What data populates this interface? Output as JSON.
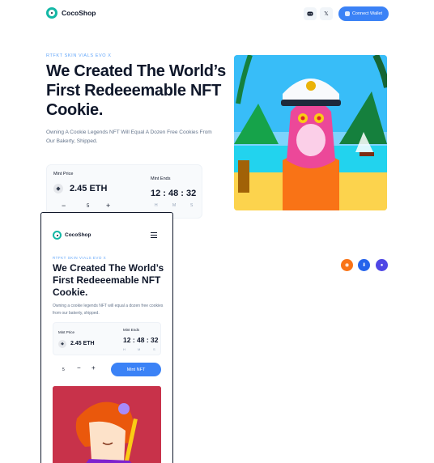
{
  "header": {
    "logo_text": "CocoShop",
    "discord_icon": "discord-icon",
    "x_icon": "𝕏",
    "connect_label": "Connect Wallet",
    "accent": "#3b82f6"
  },
  "hero": {
    "kicker": "RTFKT SKIN VIALS EVO X",
    "title": "We Created The World’s First Redeeemable NFT Cookie.",
    "subtitle": "Owning A Cookie Legends NFT Will Equal A Dozen Free Cookies From Our Bakerty, Shipped.",
    "mint": {
      "price_label": "Mint Price",
      "price": "2.45 ETH",
      "ends_label": "Mint Ends",
      "timer": "12 : 48 : 32",
      "hours_label": "H",
      "minutes_label": "M",
      "seconds_label": "S",
      "minus": "−",
      "quantity": "5",
      "plus": "+"
    }
  },
  "socials": [
    {
      "name": "rss-icon",
      "color": "#f97316"
    },
    {
      "name": "download-icon",
      "color": "#2563eb"
    },
    {
      "name": "badge-icon",
      "color": "#4f46e5"
    }
  ],
  "mobile": {
    "logo_text": "CocoShop",
    "kicker": "RTFKT SKIN VIALS EVO X",
    "title": "We Created The World’s First Redeeemable NFT Cookie.",
    "subtitle": "Owning a cookie legends NFT will equal a dozen free cookies from our bakerty, shipped.",
    "price_label": "Mint Price",
    "price": "2.45 ETH",
    "ends_label": "Mint Ends",
    "timer": "12 : 48 : 32",
    "hours_label": "H",
    "minutes_label": "M",
    "seconds_label": "S",
    "quantity": "5",
    "minus": "−",
    "plus": "+",
    "mint_button": "Mint NFT"
  }
}
